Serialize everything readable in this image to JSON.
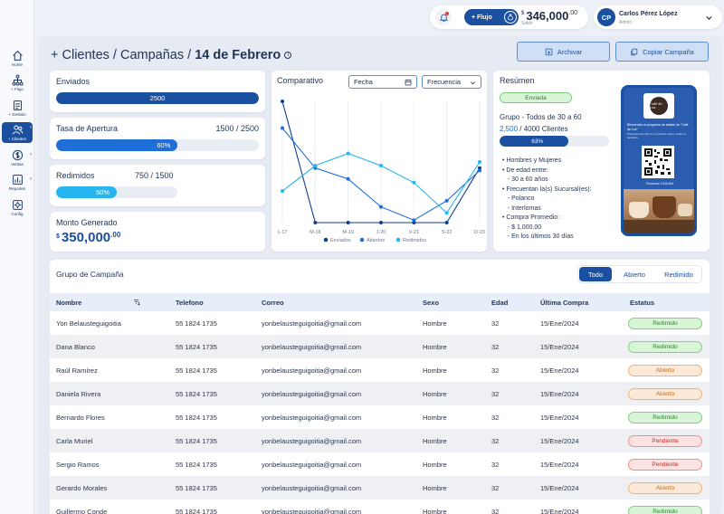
{
  "sidebar": {
    "items": [
      {
        "label": "Home",
        "icon": "home-icon"
      },
      {
        "label": "+ Flujo",
        "icon": "flow-icon"
      },
      {
        "label": "+ Gestión",
        "icon": "document-icon"
      },
      {
        "label": "+ Clientes",
        "icon": "clients-icon"
      },
      {
        "label": "Ventas",
        "icon": "dollar-icon"
      },
      {
        "label": "Reportes",
        "icon": "reports-icon"
      },
      {
        "label": "Config",
        "icon": "gear-icon"
      }
    ]
  },
  "topbar": {
    "flujo_button": "+ Flujo",
    "balance_symbol": "$",
    "balance_value": "346,000",
    "balance_cents": ".00",
    "balance_label": "Saldo",
    "user_initials": "CP",
    "user_name": "Carlos Pérez López",
    "user_role": "Admin"
  },
  "header": {
    "breadcrumb": "+ Clientes / Campañas /",
    "date": "14 de Febrero",
    "archive_button": "Archivar",
    "copy_button": "Copiar Campaña"
  },
  "metrics": {
    "enviados": {
      "label": "Enviados",
      "bar_text": "2500",
      "fill": 1.0
    },
    "apertura": {
      "label": "Tasa de Apertura",
      "value": "1500 / 2500",
      "bar_text": "60%",
      "fill": 0.6
    },
    "redimidos": {
      "label": "Redimidos",
      "value": "750 / 1500",
      "bar_text": "50%",
      "fill": 0.5
    },
    "monto": {
      "label": "Monto Generado",
      "currency": "$",
      "value": "350,000",
      "cents": ".00"
    }
  },
  "comparativo": {
    "title": "Comparativo",
    "fecha_dropdown": "Fecha",
    "frecuencia_dropdown": "Frecuencia"
  },
  "chart_data": {
    "type": "line",
    "title": "Comparativo",
    "x": [
      "L-17",
      "M-18",
      "M-19",
      "J-20",
      "V-21",
      "S-22",
      "D-23"
    ],
    "series": [
      {
        "name": "Enviados",
        "color": "#0d3f8f",
        "values": [
          100,
          0,
          0,
          0,
          0,
          0,
          45
        ]
      },
      {
        "name": "Abiertos",
        "color": "#1e6fd8",
        "values": [
          78,
          45,
          36,
          13,
          2,
          18,
          43
        ]
      },
      {
        "name": "Redimidos",
        "color": "#25b6f0",
        "values": [
          26,
          47,
          57,
          47,
          33,
          8,
          50
        ]
      }
    ],
    "ylim": [
      0,
      100
    ],
    "grid": "vertical",
    "legend": "bottom"
  },
  "resumen": {
    "title": "Resúmen",
    "status": "Enviada",
    "group_title": "Grupo - Todos de 30 a 60",
    "clients_count": "2,500",
    "clients_total": "/ 4000 Clientes",
    "bar_text": "63%",
    "fill": 0.63,
    "criteria": [
      "• Hombres y Mujeres",
      "• De edad entre:",
      "   - 30 a 60 años",
      "• Frecuentan la(s) Sucursal(es):",
      "   - Polanco",
      "   - Interlomas",
      "• Compra Promedio:",
      "   - $ 1,000.00",
      "   - En los últimos 30 días"
    ],
    "phone_logo": "Café de Luz",
    "phone_text": "Bienvenido al programa de lealtad de \"Café de Luz\"",
    "phone_subtext": "Presenta este QR en tu próxima visita y recibe tu beneficio.",
    "phone_code": "Promoción C240-504"
  },
  "table": {
    "title": "Grupo de Campaña",
    "filters": [
      "Todo",
      "Abierto",
      "Redimido"
    ],
    "columns": [
      "Nombre",
      "Telefono",
      "Correo",
      "Sexo",
      "Edad",
      "Última Compra",
      "Estatus"
    ],
    "rows": [
      {
        "name": "Yon Belausteguigoitia",
        "phone": "55 1824 1735",
        "email": "yonbelausteguigoitia@gmail.com",
        "sex": "Hombre",
        "age": "32",
        "last": "15/Ene/2024",
        "status": "Redimido",
        "kind": "g"
      },
      {
        "name": "Dana Blanco",
        "phone": "55 1824 1735",
        "email": "yonbelausteguigoitia@gmail.com",
        "sex": "Hombre",
        "age": "32",
        "last": "15/Ene/2024",
        "status": "Redimido",
        "kind": "g"
      },
      {
        "name": "Raúl Ramírez",
        "phone": "55 1824 1735",
        "email": "yonbelausteguigoitia@gmail.com",
        "sex": "Hombre",
        "age": "32",
        "last": "15/Ene/2024",
        "status": "Abierto",
        "kind": "o"
      },
      {
        "name": "Daniela Rivera",
        "phone": "55 1824 1735",
        "email": "yonbelausteguigoitia@gmail.com",
        "sex": "Hombre",
        "age": "32",
        "last": "15/Ene/2024",
        "status": "Abierto",
        "kind": "o"
      },
      {
        "name": "Bernardo Flores",
        "phone": "55 1824 1735",
        "email": "yonbelausteguigoitia@gmail.com",
        "sex": "Hombre",
        "age": "32",
        "last": "15/Ene/2024",
        "status": "Redimido",
        "kind": "g"
      },
      {
        "name": "Carla Muriel",
        "phone": "55 1824 1735",
        "email": "yonbelausteguigoitia@gmail.com",
        "sex": "Hombre",
        "age": "32",
        "last": "15/Ene/2024",
        "status": "Pendiente",
        "kind": "r"
      },
      {
        "name": "Sergio Ramos",
        "phone": "55 1824 1735",
        "email": "yonbelausteguigoitia@gmail.com",
        "sex": "Hombre",
        "age": "32",
        "last": "15/Ene/2024",
        "status": "Pendiente",
        "kind": "r"
      },
      {
        "name": "Gerardo Morales",
        "phone": "55 1824 1735",
        "email": "yonbelausteguigoitia@gmail.com",
        "sex": "Hombre",
        "age": "32",
        "last": "15/Ene/2024",
        "status": "Abierto",
        "kind": "o"
      },
      {
        "name": "Guillermo Conde",
        "phone": "55 1824 1735",
        "email": "yonbelausteguigoitia@gmail.com",
        "sex": "Hombre",
        "age": "32",
        "last": "15/Ene/2024",
        "status": "Redimido",
        "kind": "g"
      }
    ]
  },
  "colors": {
    "primary": "#1b4fa0",
    "accent": "#25b6f0",
    "bg": "#e6ebf3"
  }
}
